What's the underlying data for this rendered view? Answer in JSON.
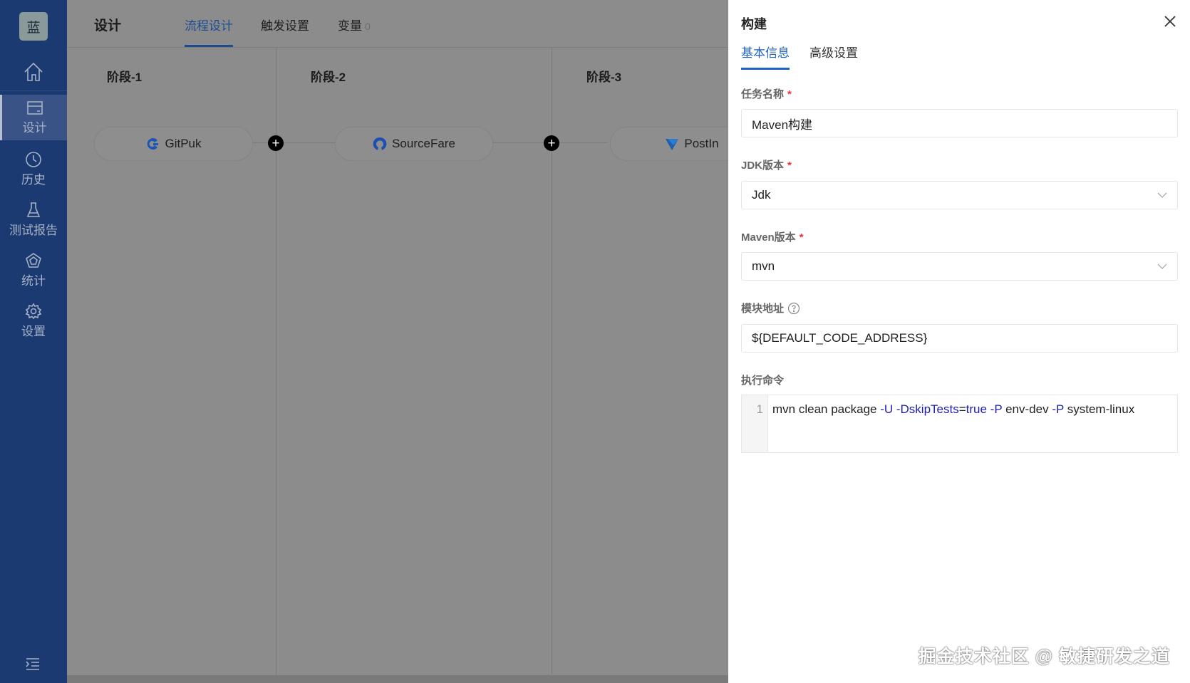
{
  "sidebar": {
    "logo": "蓝",
    "items": [
      {
        "label": "设计",
        "icon": "card-icon",
        "active": true
      },
      {
        "label": "历史",
        "icon": "clock-icon"
      },
      {
        "label": "测试报告",
        "icon": "flask-icon"
      },
      {
        "label": "统计",
        "icon": "pentagon-chart-icon"
      },
      {
        "label": "设置",
        "icon": "gear-icon"
      }
    ]
  },
  "header": {
    "title": "设计",
    "tabs": [
      {
        "label": "流程设计",
        "active": true
      },
      {
        "label": "触发设置"
      },
      {
        "label": "变量",
        "count": "0"
      }
    ]
  },
  "pipeline": {
    "stages": [
      {
        "title": "阶段-1",
        "node": "GitPuk"
      },
      {
        "title": "阶段-2",
        "node": "SourceFare"
      },
      {
        "title": "阶段-3",
        "node": "PostIn"
      }
    ]
  },
  "panel": {
    "title": "构建",
    "tabs": [
      {
        "label": "基本信息",
        "active": true
      },
      {
        "label": "高级设置"
      }
    ],
    "fields": {
      "task_name": {
        "label": "任务名称",
        "value": "Maven构建"
      },
      "jdk": {
        "label": "JDK版本",
        "value": "Jdk"
      },
      "maven": {
        "label": "Maven版本",
        "value": "mvn"
      },
      "module": {
        "label": "模块地址",
        "value": "${DEFAULT_CODE_ADDRESS}"
      },
      "command": {
        "label": "执行命令",
        "line": "1",
        "tokens": [
          "mvn clean package ",
          "-U -DskipTests",
          "=",
          "true -P",
          " env-dev ",
          "-P",
          " system-linux"
        ]
      }
    },
    "accent": "#1f63c6"
  },
  "watermark": "掘金技术社区 @ 敏捷研发之道"
}
